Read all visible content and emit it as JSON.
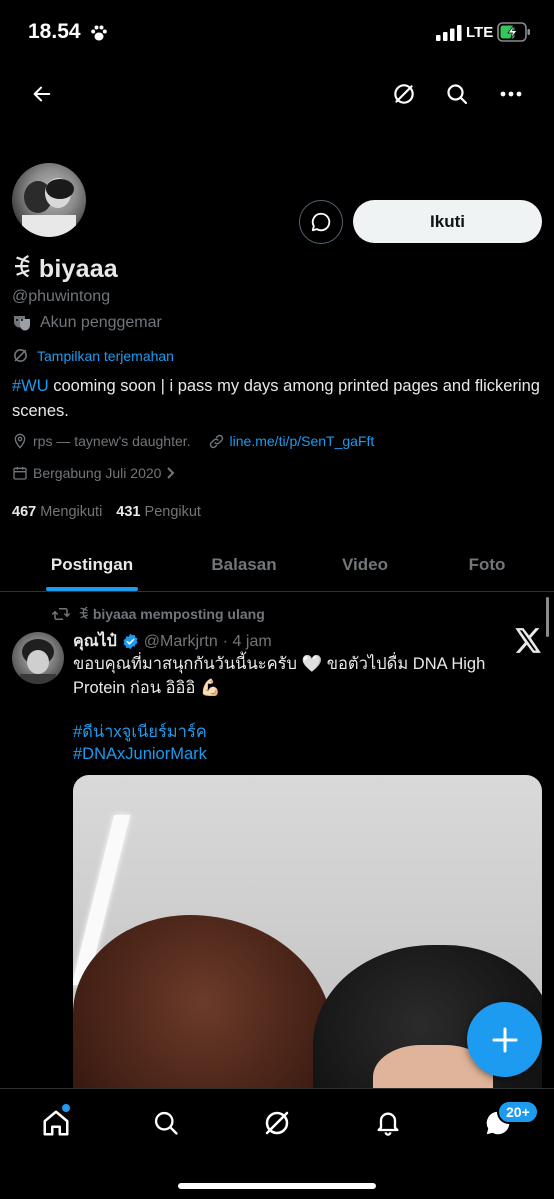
{
  "status_bar": {
    "time": "18.54",
    "network": "LTE",
    "icons": [
      "paw-icon",
      "signal-icon",
      "battery-charging-icon"
    ]
  },
  "nav": {
    "icons": [
      "back-arrow-icon",
      "translate-icon",
      "search-icon",
      "more-icon"
    ]
  },
  "profile": {
    "display_name": "ꉂ biyaaa",
    "handle": "@phuwintong",
    "fan_label": "Akun penggemar",
    "translate_label": "Tampilkan terjemahan",
    "bio_hashtag": "#WU",
    "bio_text": " cooming soon | i pass my days among printed pages and flickering scenes.",
    "location": "rps — taynew's daughter.",
    "link": "line.me/ti/p/SenT_gaFft",
    "joined": "Bergabung Juli 2020",
    "following_count": "467",
    "following_label": "Mengikuti",
    "followers_count": "431",
    "followers_label": "Pengikut",
    "follow_button": "Ikuti"
  },
  "tabs": [
    "Postingan",
    "Balasan",
    "Video",
    "Foto"
  ],
  "active_tab": "Postingan",
  "post": {
    "repost_label": "ꉂ biyaaa memposting ulang",
    "author": "คุณไป๋",
    "verified": true,
    "handle": "@Markjrtn",
    "time": "· 4 jam",
    "text": "ขอบคุณที่มาสนุกกันวันนี้นะครับ 🤍 ขอตัวไปดื่ม DNA High Protein ก่อน อิอิอิ 💪🏻",
    "hashtag_1": "#ดีน่าxจูเนียร์มาร์ค",
    "hashtag_2": "#DNAxJuniorMark"
  },
  "bottom_nav": {
    "message_badge": "20+",
    "icons": [
      "home-icon",
      "search-icon",
      "grok-icon",
      "notifications-icon",
      "messages-icon"
    ]
  },
  "colors": {
    "background": "#000000",
    "accent": "#1d9bf0",
    "text": "#e7e9ea",
    "muted": "#71767b"
  }
}
